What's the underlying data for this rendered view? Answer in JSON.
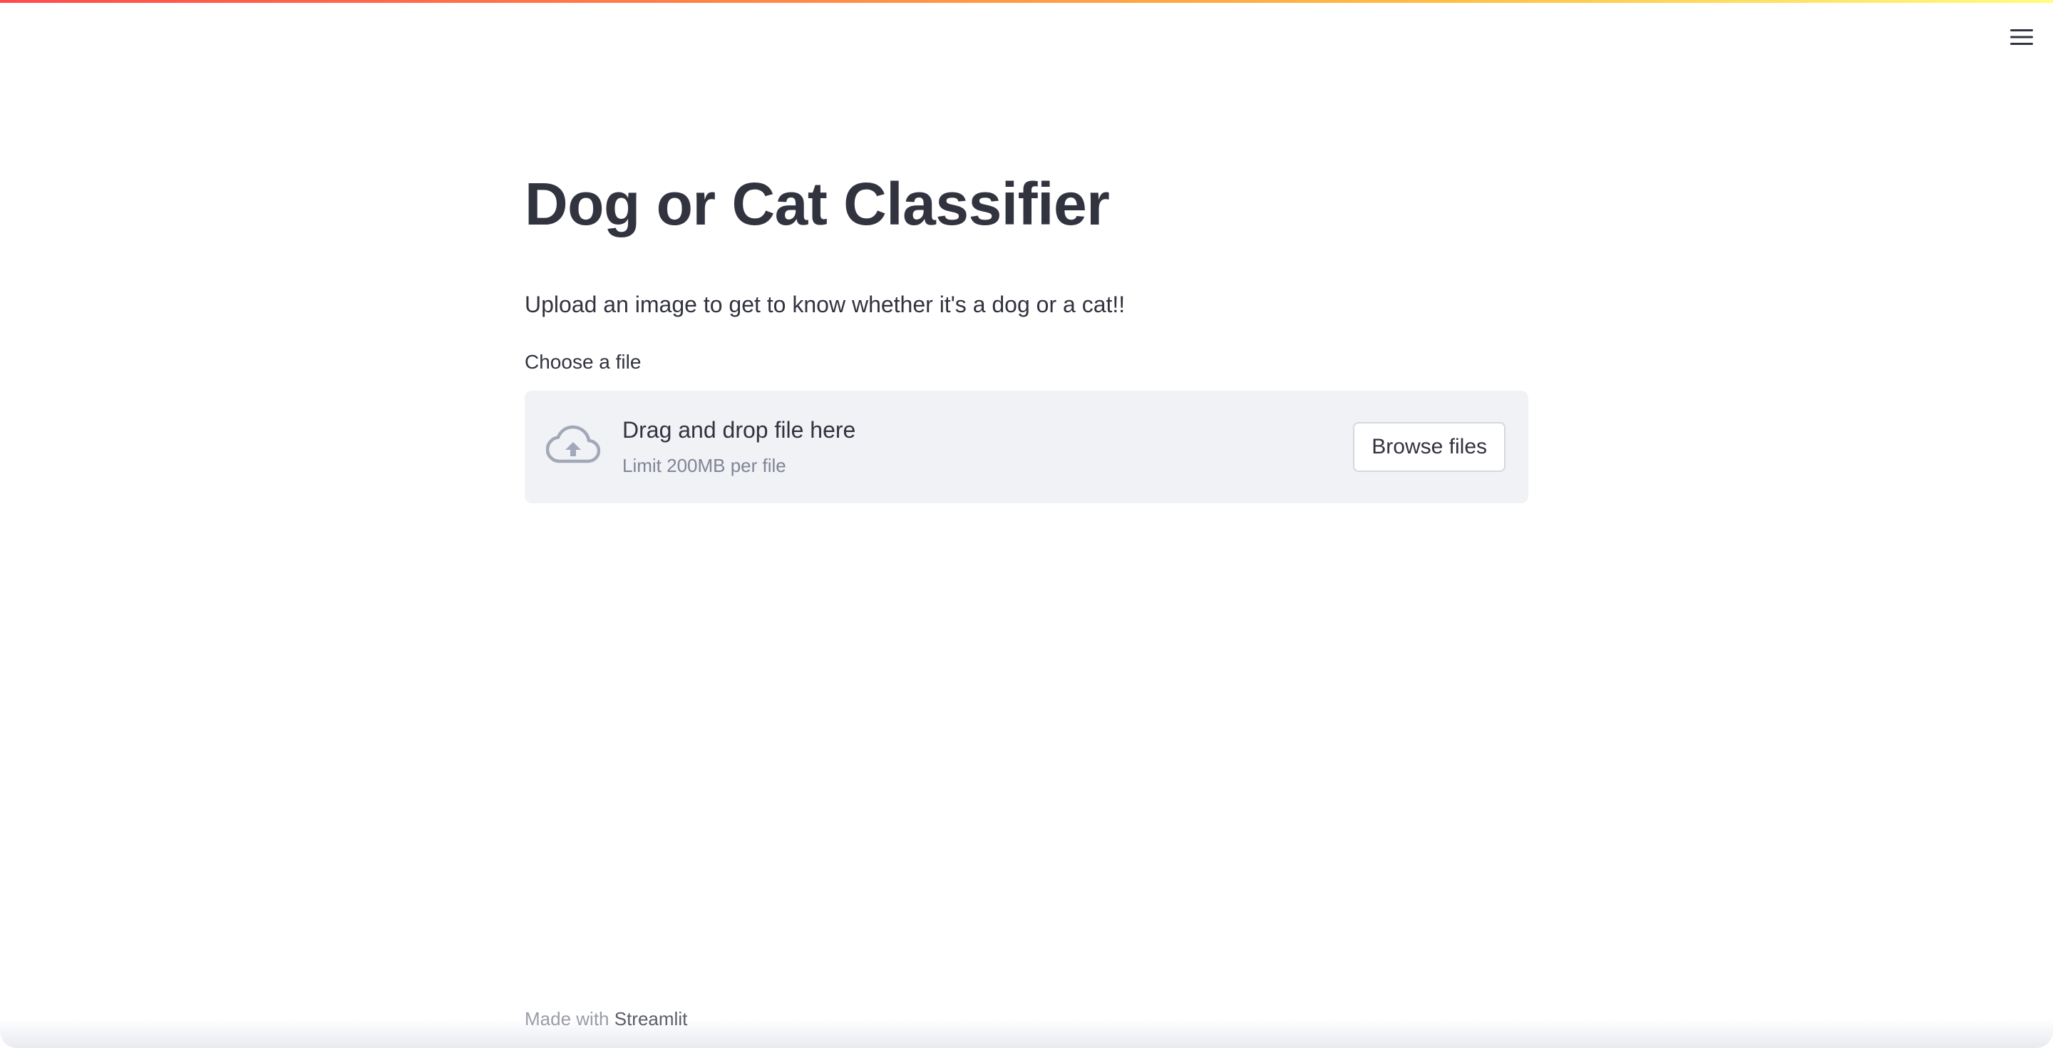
{
  "app": {
    "title": "Dog or Cat Classifier",
    "subtitle": "Upload an image to get to know whether it's a dog or a cat!!",
    "menu_icon": "hamburger-menu-icon"
  },
  "uploader": {
    "label": "Choose a file",
    "instructions": "Drag and drop file here",
    "limit": "Limit 200MB per file",
    "button_label": "Browse files",
    "icon": "cloud-upload-icon"
  },
  "footer": {
    "prefix": "Made with ",
    "link_label": "Streamlit"
  },
  "colors": {
    "text": "#31333f",
    "muted": "#808495",
    "dropzone_bg": "#f0f2f6",
    "icon": "#a3a8b8",
    "accent_gradient_start": "#ff4b4b",
    "accent_gradient_end": "#fffd80"
  }
}
